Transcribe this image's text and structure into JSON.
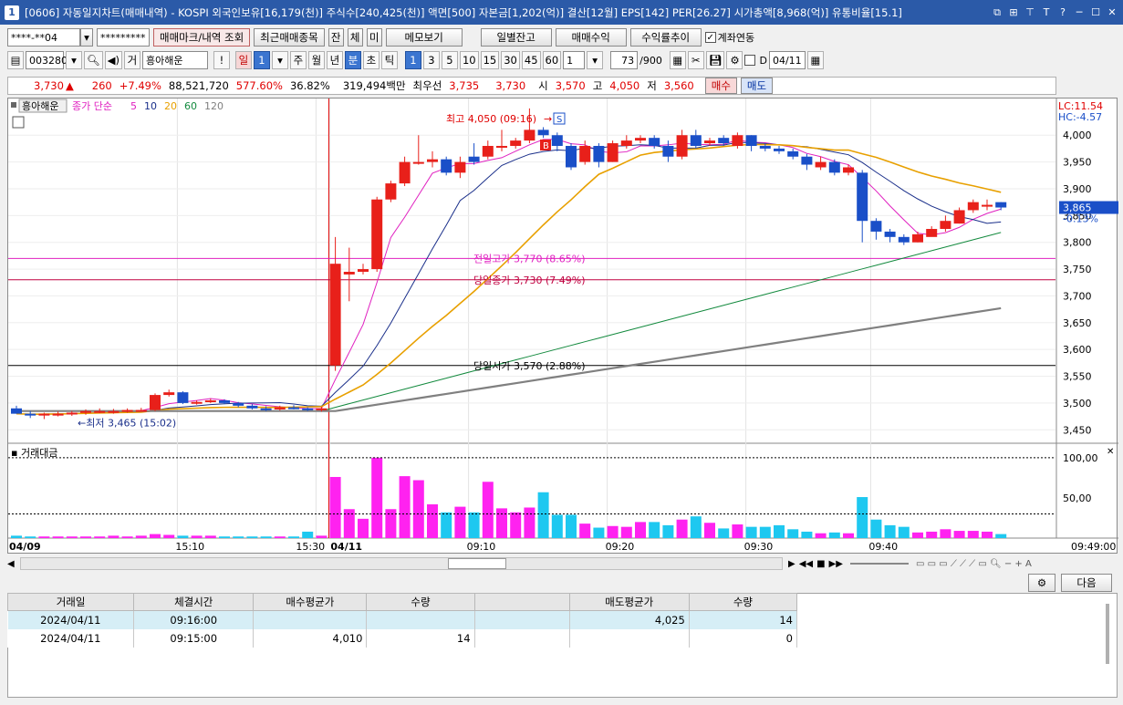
{
  "title": "[0606] 자동일지차트(매매내역) - KOSPI 외국인보유[16,179(천)] 주식수[240,425(천)] 액면[500] 자본금[1,202(억)] 결산[12월] EPS[142] PER[26.27] 시가총액[8,968(억)] 유통비율[15.1]",
  "app_icon": "1",
  "toolbar1": {
    "account": "****-**04",
    "password": "*********",
    "btn_mark": "매매마크/내역 조회",
    "btn_recent": "최근매매종목",
    "btn_jan": "잔",
    "btn_che": "체",
    "btn_mi": "미",
    "btn_memo": "메모보기",
    "btn_daily": "일별잔고",
    "btn_profit": "매매수익",
    "btn_rate": "수익률추이",
    "link_label": "계좌연동"
  },
  "toolbar2": {
    "code": "003280",
    "gu": "거",
    "name": "흥아해운",
    "excl": "!",
    "periods": [
      "일",
      "주",
      "월",
      "년",
      "분",
      "초",
      "틱"
    ],
    "period_sel": "1",
    "nums": [
      "1",
      "3",
      "5",
      "10",
      "15",
      "30",
      "45",
      "60"
    ],
    "interval": "1",
    "count": "73",
    "count_total": "/900",
    "date": "04/11",
    "d_label": "D"
  },
  "quote": {
    "price": "3,730",
    "arrow": "▲",
    "change": "260",
    "pct": "+7.49%",
    "volume": "88,521,720",
    "vol_pct": "577.60%",
    "turnover": "36.82%",
    "amount": "319,494백만",
    "best_label": "최우선",
    "ask": "3,735",
    "bid": "3,730",
    "open_label": "시",
    "open": "3,570",
    "high_label": "고",
    "high": "4,050",
    "low_label": "저",
    "low": "3,560",
    "buy": "매수",
    "sell": "매도"
  },
  "legend": {
    "name": "흥아해운",
    "ma_label": "종가 단순",
    "ma": [
      "5",
      "10",
      "20",
      "60",
      "120"
    ],
    "ma_colors": [
      "#e020c0",
      "#1a2f8a",
      "#e8a000",
      "#138a3e",
      "#808080"
    ],
    "lc": "LC:11.54",
    "hc": "HC:-4.57"
  },
  "annotations": {
    "high": "최고 4,050 (09:16)",
    "low": "최저 3,465 (15:02)",
    "prev_high": "전일고가 3,770 (8.65%)",
    "prev_close": "당일종가 3,730 (7.49%)",
    "today_open": "당일시가 3,570 (2.88%)",
    "price_tag": "3,865",
    "price_tag_pct": "-0.13%",
    "mark_b": "B",
    "mark_s": "S"
  },
  "price_axis": [
    "4,000",
    "3,950",
    "3,900",
    "3,850",
    "3,800",
    "3,750",
    "3,700",
    "3,650",
    "3,600",
    "3,550",
    "3,500",
    "3,450"
  ],
  "volume_axis": [
    "100,00",
    "50,00"
  ],
  "volume_label": "거래대금",
  "time_labels": [
    "04/09",
    "15:10",
    "15:30",
    "04/11",
    "09:10",
    "09:20",
    "09:30",
    "09:40",
    "09:49:00"
  ],
  "chart_data": {
    "type": "candlestick",
    "x": [
      "04/09 15:0x",
      "",
      "",
      "",
      "",
      "",
      "",
      "",
      "",
      "",
      "",
      "",
      "",
      "",
      "",
      "",
      "",
      "",
      "",
      "",
      "",
      "",
      "",
      "04/11 09:01",
      "09:02",
      "09:03",
      "09:04",
      "09:05",
      "09:06",
      "09:07",
      "09:08",
      "09:09",
      "09:10",
      "09:11",
      "09:12",
      "09:13",
      "09:14",
      "09:15",
      "09:16",
      "09:17",
      "09:18",
      "09:19",
      "09:20",
      "09:21",
      "09:22",
      "09:23",
      "09:24",
      "09:25",
      "09:26",
      "09:27",
      "09:28",
      "09:29",
      "09:30",
      "09:31",
      "09:32",
      "09:33",
      "09:34",
      "09:35",
      "09:36",
      "09:37",
      "09:38",
      "09:39",
      "09:40",
      "09:41",
      "09:42",
      "09:43",
      "09:44",
      "09:45",
      "09:46",
      "09:47",
      "09:48",
      "09:49"
    ],
    "open": [
      3490,
      3480,
      3478,
      3480,
      3480,
      3482,
      3485,
      3485,
      3485,
      3487,
      3487,
      3515,
      3520,
      3500,
      3502,
      3505,
      3500,
      3495,
      3490,
      3488,
      3492,
      3490,
      3488,
      3570,
      3740,
      3745,
      3750,
      3880,
      3910,
      3950,
      3950,
      3955,
      3930,
      3960,
      3960,
      3980,
      3980,
      3990,
      4010,
      4000,
      3980,
      3950,
      3980,
      3950,
      3980,
      3990,
      3995,
      3980,
      3960,
      4000,
      3985,
      3995,
      3980,
      4000,
      3980,
      3975,
      3970,
      3960,
      3940,
      3950,
      3930,
      3930,
      3840,
      3820,
      3810,
      3800,
      3810,
      3825,
      3835,
      3860,
      3870,
      3875
    ],
    "close": [
      3480,
      3478,
      3480,
      3480,
      3482,
      3485,
      3485,
      3485,
      3487,
      3487,
      3515,
      3520,
      3500,
      3502,
      3505,
      3500,
      3495,
      3490,
      3488,
      3492,
      3490,
      3488,
      3490,
      3760,
      3745,
      3750,
      3880,
      3910,
      3950,
      3950,
      3955,
      3930,
      3950,
      3950,
      3980,
      3980,
      3990,
      4010,
      4000,
      3980,
      3940,
      3980,
      3950,
      3985,
      3990,
      3995,
      3980,
      3960,
      4000,
      3980,
      3990,
      3985,
      4000,
      3980,
      3975,
      3970,
      3960,
      3945,
      3950,
      3930,
      3940,
      3840,
      3820,
      3810,
      3800,
      3815,
      3825,
      3840,
      3860,
      3875,
      3870,
      3865
    ],
    "high": [
      3495,
      3485,
      3482,
      3484,
      3485,
      3488,
      3490,
      3489,
      3490,
      3491,
      3518,
      3525,
      3522,
      3505,
      3508,
      3507,
      3502,
      3498,
      3494,
      3495,
      3496,
      3492,
      3493,
      3810,
      3790,
      3760,
      3885,
      3915,
      3960,
      4000,
      3970,
      3960,
      3960,
      3985,
      3990,
      4010,
      3995,
      4050,
      4015,
      4005,
      3985,
      3990,
      3985,
      3990,
      4000,
      4000,
      4000,
      3990,
      4010,
      4010,
      3995,
      4000,
      4005,
      4000,
      3985,
      3980,
      3975,
      3965,
      3960,
      3955,
      3945,
      3935,
      3845,
      3825,
      3815,
      3820,
      3830,
      3850,
      3865,
      3880,
      3880,
      3875
    ],
    "low": [
      3480,
      3472,
      3470,
      3475,
      3476,
      3478,
      3481,
      3480,
      3482,
      3484,
      3485,
      3512,
      3498,
      3497,
      3500,
      3498,
      3492,
      3488,
      3485,
      3486,
      3488,
      3485,
      3484,
      3560,
      3690,
      3740,
      3745,
      3875,
      3905,
      3945,
      3940,
      3925,
      3920,
      3945,
      3955,
      3970,
      3975,
      3985,
      3995,
      3970,
      3935,
      3945,
      3940,
      3950,
      3975,
      3985,
      3975,
      3950,
      3955,
      3975,
      3980,
      3980,
      3975,
      3970,
      3970,
      3965,
      3955,
      3935,
      3935,
      3925,
      3925,
      3800,
      3805,
      3800,
      3795,
      3800,
      3815,
      3820,
      3835,
      3855,
      3860,
      3860
    ],
    "volume": [
      3,
      2,
      2,
      2,
      2,
      2,
      2,
      3,
      2,
      3,
      5,
      4,
      3,
      3,
      3,
      2,
      2,
      2,
      2,
      2,
      2,
      8,
      3,
      76,
      36,
      24,
      100,
      36,
      77,
      72,
      42,
      32,
      39,
      32,
      70,
      37,
      32,
      38,
      57,
      29,
      29,
      18,
      13,
      15,
      14,
      20,
      20,
      16,
      23,
      27,
      19,
      12,
      17,
      14,
      14,
      16,
      11,
      8,
      6,
      7,
      6,
      51,
      23,
      16,
      14,
      7,
      8,
      11,
      9,
      9,
      8,
      5
    ],
    "ylim": [
      3430,
      4060
    ],
    "volume_ylim": [
      0,
      110
    ],
    "ma5_color": "#e020c0",
    "ma10_color": "#1a2f8a",
    "ma20_color": "#e8a000",
    "ma60_color": "#138a3e",
    "ma120_color": "#808080"
  },
  "scroll_controls": {
    "next": "다음"
  },
  "table": {
    "headers": [
      "거래일",
      "체결시간",
      "매수평균가",
      "수량",
      "",
      "매도평균가",
      "수량"
    ],
    "rows": [
      [
        "2024/04/11",
        "09:16:00",
        "",
        "",
        "",
        "4,025",
        "14"
      ],
      [
        "2024/04/11",
        "09:15:00",
        "4,010",
        "14",
        "",
        "",
        "0"
      ]
    ]
  }
}
